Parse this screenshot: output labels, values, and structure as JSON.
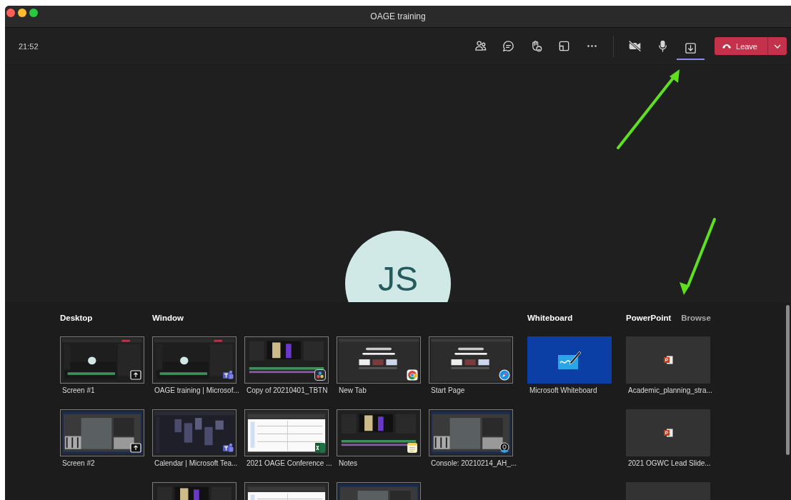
{
  "window": {
    "title": "OAGE training"
  },
  "toolbar": {
    "time": "21:52",
    "buttons": [
      {
        "kind": "people",
        "selected": false
      },
      {
        "kind": "chat",
        "selected": false
      },
      {
        "kind": "reactions",
        "selected": false
      },
      {
        "kind": "rooms",
        "selected": false
      },
      {
        "kind": "more",
        "selected": false
      },
      {
        "kind": "camera",
        "selected": false
      },
      {
        "kind": "mic",
        "selected": false
      },
      {
        "kind": "share",
        "selected": true
      }
    ],
    "leave": {
      "label": "Leave"
    }
  },
  "stage": {
    "avatar": {
      "initials": "JS"
    }
  },
  "share_tray": {
    "sections": [
      {
        "kind": "desktop",
        "title": "Desktop",
        "items": [
          {
            "kind": "picture",
            "label": "Screen #1",
            "badge": {
              "kind": "screen"
            }
          },
          {
            "kind": "picture",
            "label": "Screen #2",
            "badge": {
              "kind": "screen"
            }
          }
        ]
      },
      {
        "kind": "window",
        "title": "Window",
        "items": [
          {
            "kind": "picture",
            "label": "OAGE training | Microsof...",
            "badge": {
              "kind": "teams"
            }
          },
          {
            "kind": "picture",
            "label": "Copy of 20210401_TBTN",
            "badge": {
              "kind": "resolve"
            }
          },
          {
            "kind": "picture",
            "label": "New Tab",
            "badge": {
              "kind": "chrome"
            }
          },
          {
            "kind": "picture",
            "label": "Start Page",
            "badge": {
              "kind": "safari"
            }
          },
          {
            "kind": "picture",
            "label": "Calendar | Microsoft Tea...",
            "badge": {
              "kind": "teams"
            }
          },
          {
            "kind": "picture",
            "label": "2021 OAGE Conference ...",
            "badge": {
              "kind": "excel"
            }
          },
          {
            "kind": "picture",
            "label": "Notes",
            "badge": {
              "kind": "notes"
            }
          },
          {
            "kind": "picture",
            "label": "Console: 20210214_AH_...",
            "badge": {
              "kind": "console"
            }
          },
          {
            "kind": "picture"
          },
          {
            "kind": "picture"
          },
          {
            "kind": "picture"
          }
        ]
      },
      {
        "kind": "whiteboard",
        "title": "Whiteboard",
        "items": [
          {
            "kind": "whiteboard",
            "label": "Microsoft Whiteboard"
          }
        ]
      },
      {
        "kind": "powerpoint",
        "title": "PowerPoint",
        "link": "Browse",
        "items": [
          {
            "kind": "file",
            "label": "Academic_planning_stra...",
            "icon": {
              "kind": "slides"
            }
          },
          {
            "kind": "file",
            "label": "2021 OGWC Lead Slide...",
            "icon": {
              "kind": "slides"
            }
          },
          {
            "kind": "file"
          }
        ]
      }
    ]
  }
}
